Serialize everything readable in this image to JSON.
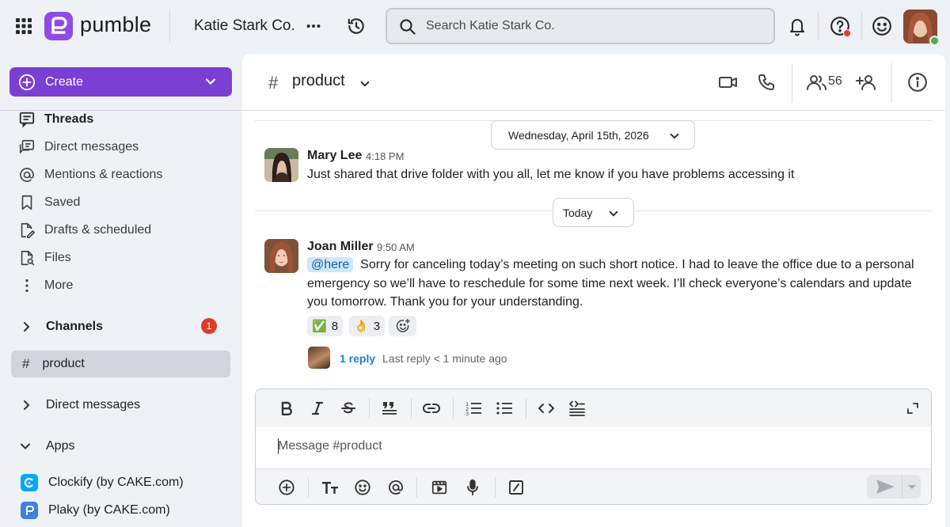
{
  "topbar": {
    "logo_text": "pumble",
    "workspace": "Katie Stark Co.",
    "search_placeholder": "Search Katie Stark Co."
  },
  "sidebar": {
    "create_label": "Create",
    "nav": [
      {
        "label": "Threads",
        "icon": "threads-icon"
      },
      {
        "label": "Direct messages",
        "icon": "direct-messages-icon"
      },
      {
        "label": "Mentions & reactions",
        "icon": "at-icon"
      },
      {
        "label": "Saved",
        "icon": "bookmark-icon"
      },
      {
        "label": "Drafts & scheduled",
        "icon": "draft-icon"
      },
      {
        "label": "Files",
        "icon": "file-icon"
      },
      {
        "label": "More",
        "icon": "more-vertical-icon"
      }
    ],
    "channels_label": "Channels",
    "channels_unread": "1",
    "active_channel": "product",
    "direct_messages_label": "Direct messages",
    "apps_label": "Apps",
    "apps": [
      {
        "label": "Clockify (by CAKE.com)",
        "color": "#03a9f4"
      },
      {
        "label": "Plaky (by CAKE.com)",
        "color": "#3f7fe0"
      }
    ]
  },
  "channel": {
    "name": "product",
    "member_count": "56"
  },
  "messages": {
    "date_divider_1": "Wednesday, April 15th, 2026",
    "date_divider_2": "Today",
    "m1": {
      "author": "Mary Lee",
      "time": "4:18 PM",
      "text": "Just shared that drive folder with you all, let me know if you have problems accessing it"
    },
    "m2": {
      "author": "Joan Miller",
      "time": "9:50 AM",
      "mention": "@here",
      "text": "Sorry for canceling today’s meeting on such short notice. I had to leave the office due to a personal emergency so we’ll have to reschedule for some time next week. I’ll check everyone’s calendars and update you tomorrow. Thank you for your understanding.",
      "reactions": [
        {
          "emoji": "✅",
          "count": "8"
        },
        {
          "emoji": "👌",
          "count": "3"
        }
      ],
      "reply_count": "1 reply",
      "reply_meta": "Last reply < 1 minute ago"
    }
  },
  "composer": {
    "placeholder": "Message #product"
  },
  "colors": {
    "accent": "#7b3fd4",
    "link": "#1e7fd6",
    "badge": "#e03b24"
  }
}
